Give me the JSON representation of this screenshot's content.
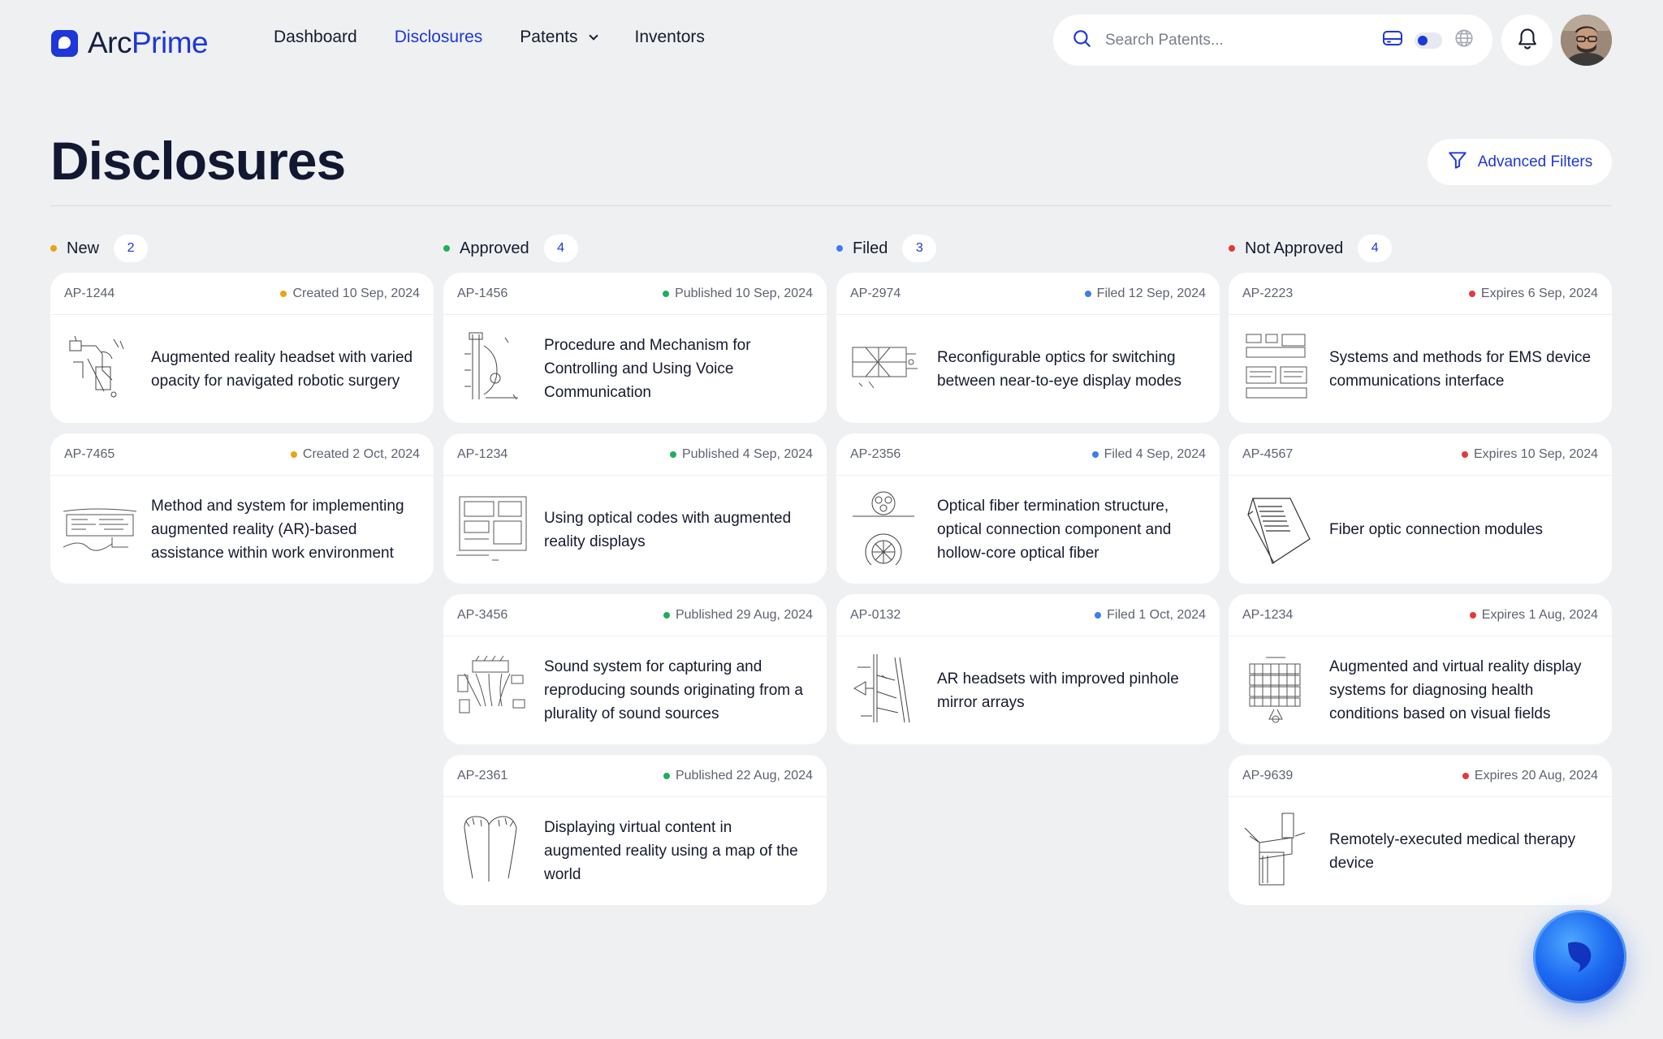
{
  "app": {
    "logo_text_a": "Arc",
    "logo_text_b": "Prime",
    "brand_color": "#1d37d8"
  },
  "nav": {
    "items": [
      {
        "label": "Dashboard"
      },
      {
        "label": "Disclosures",
        "active": true
      },
      {
        "label": "Patents",
        "has_dropdown": true
      },
      {
        "label": "Inventors"
      }
    ]
  },
  "search": {
    "placeholder": "Search Patents...",
    "icons": [
      "search-icon",
      "card-icon",
      "toggle-switch",
      "globe-icon"
    ]
  },
  "header_actions": {
    "icons": [
      "bell-icon",
      "avatar"
    ]
  },
  "page": {
    "title": "Disclosures",
    "filters_label": "Advanced Filters",
    "filters_icon": "filter-icon"
  },
  "columns": [
    {
      "name": "New",
      "count": "2",
      "color": "#e8a317",
      "cards": [
        {
          "id": "AP-1244",
          "date": "Created 10 Sep, 2024",
          "title": "Augmented reality headset with varied opacity for navigated robotic surgery"
        },
        {
          "id": "AP-7465",
          "date": "Created 2 Oct, 2024",
          "title": "Method and system for implementing augmented reality (AR)-based assistance within work environment"
        }
      ]
    },
    {
      "name": "Approved",
      "count": "4",
      "color": "#1fae5b",
      "cards": [
        {
          "id": "AP-1456",
          "date": "Published 10 Sep, 2024",
          "title": "Procedure and Mechanism for Controlling and Using Voice Communication"
        },
        {
          "id": "AP-1234",
          "date": "Published 4 Sep, 2024",
          "title": "Using optical codes with augmented reality displays"
        },
        {
          "id": "AP-3456",
          "date": "Published 29 Aug, 2024",
          "title": "Sound system for capturing and reproducing sounds originating from a plurality of sound sources"
        },
        {
          "id": "AP-2361",
          "date": "Published 22 Aug, 2024",
          "title": "Displaying virtual content in augmented reality using a map of the world"
        }
      ]
    },
    {
      "name": "Filed",
      "count": "3",
      "color": "#3b7cf4",
      "cards": [
        {
          "id": "AP-2974",
          "date": "Filed 12 Sep, 2024",
          "title": "Reconfigurable optics for switching between near-to-eye display modes"
        },
        {
          "id": "AP-2356",
          "date": "Filed 4 Sep, 2024",
          "title": "Optical fiber termination structure, optical connection component and hollow-core optical fiber"
        },
        {
          "id": "AP-0132",
          "date": "Filed  1 Oct, 2024",
          "title": "AR headsets with improved pinhole mirror arrays"
        }
      ]
    },
    {
      "name": "Not Approved",
      "count": "4",
      "color": "#e5383b",
      "cards": [
        {
          "id": "AP-2223",
          "date": "Expires  6 Sep, 2024",
          "title": "Systems and methods for EMS device communications interface"
        },
        {
          "id": "AP-4567",
          "date": "Expires  10 Sep, 2024",
          "title": "Fiber optic connection modules"
        },
        {
          "id": "AP-1234",
          "date": "Expires  1 Aug, 2024",
          "title": "Augmented and virtual reality display systems for diagnosing health conditions based on visual fields"
        },
        {
          "id": "AP-9639",
          "date": "Expires 20 Aug, 2024",
          "title": "Remotely-executed medical therapy device"
        }
      ]
    }
  ],
  "assistant": {
    "icon": "assistant-chat-icon"
  }
}
